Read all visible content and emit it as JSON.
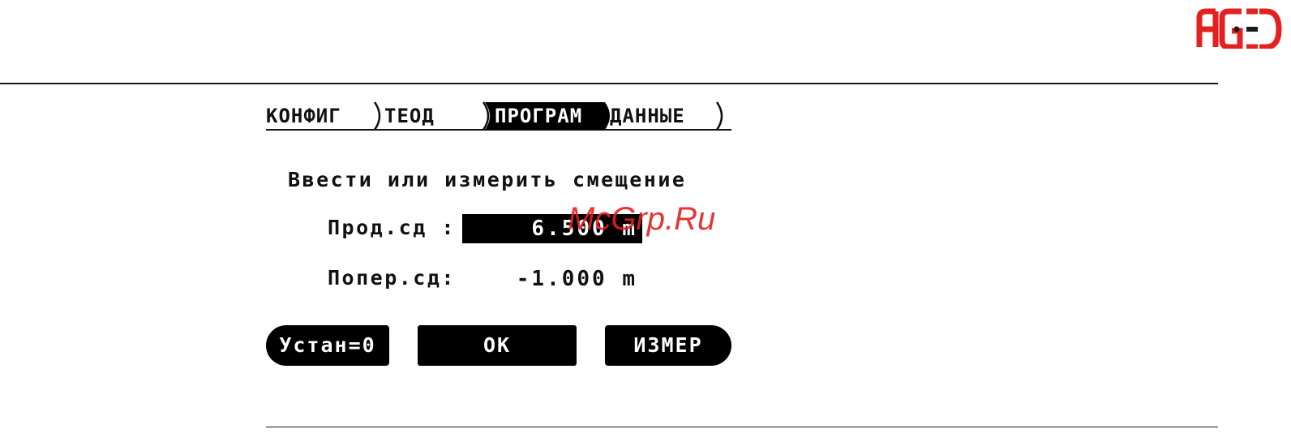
{
  "brand": {
    "logo_text": "AGED",
    "accent_color": "#e52020"
  },
  "tabs": [
    {
      "label": "КОНФИГ",
      "active": false
    },
    {
      "label": "ТЕОД",
      "active": false
    },
    {
      "label": "ПРОГРАМ",
      "active": true
    },
    {
      "label": "ДАННЫЕ",
      "active": false
    }
  ],
  "screen": {
    "prompt": "Ввести или измерить смещение",
    "fields": [
      {
        "label": "Прод.сд :",
        "value": "6.500 m",
        "selected": true
      },
      {
        "label": "Попер.сд:",
        "value": "-1.000 m",
        "selected": false
      }
    ]
  },
  "softkeys": {
    "left": "Устан=0",
    "middle": "OK",
    "right": "ИЗМЕР"
  },
  "watermark": "McGrp.Ru"
}
